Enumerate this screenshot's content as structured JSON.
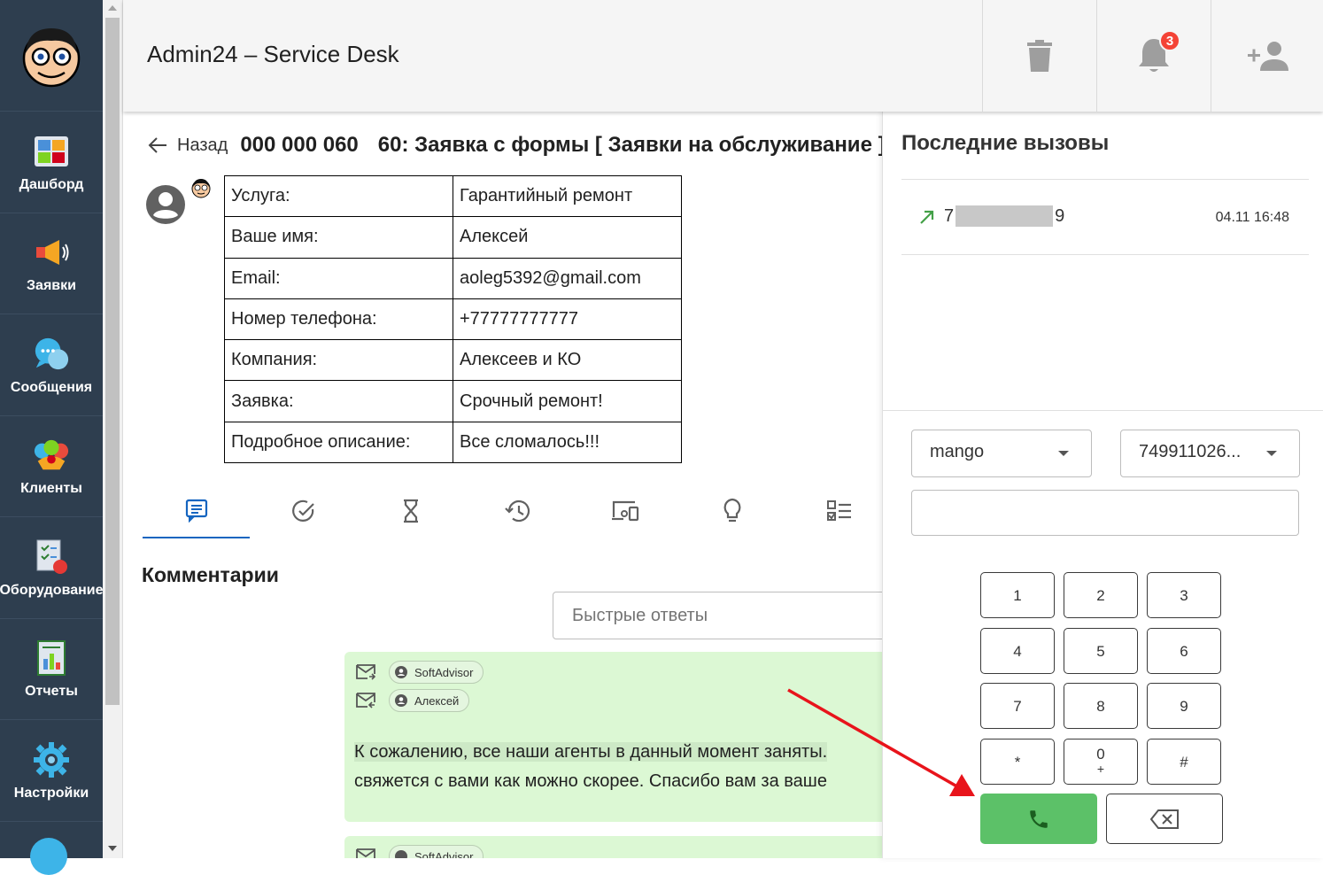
{
  "header": {
    "title": "Admin24 – Service Desk",
    "notification_count": "3"
  },
  "sidebar": {
    "items": [
      {
        "label": "Дашборд",
        "icon": "dashboard-icon"
      },
      {
        "label": "Заявки",
        "icon": "megaphone-icon"
      },
      {
        "label": "Сообщения",
        "icon": "chat-bubbles-icon"
      },
      {
        "label": "Клиенты",
        "icon": "clients-icon"
      },
      {
        "label": "Оборудование",
        "icon": "equipment-icon"
      },
      {
        "label": "Отчеты",
        "icon": "report-icon"
      },
      {
        "label": "Настройки",
        "icon": "gear-icon"
      }
    ]
  },
  "ticket": {
    "back_label": "Назад",
    "number": "000 000 060",
    "title": "60: Заявка с формы [ Заявки на обслуживание ]",
    "fields": [
      {
        "key": "Услуга:",
        "value": "Гарантийный ремонт"
      },
      {
        "key": "Ваше имя:",
        "value": "Алексей"
      },
      {
        "key": "Email:",
        "value": "aoleg5392@gmail.com"
      },
      {
        "key": "Номер телефона:",
        "value": "+77777777777"
      },
      {
        "key": "Компания:",
        "value": "Алексеев и КО"
      },
      {
        "key": "Заявка:",
        "value": "Срочный ремонт!"
      },
      {
        "key": "Подробное описание:",
        "value": "Все сломалось!!!"
      }
    ]
  },
  "tabs": [
    "comments-icon",
    "check-circle-icon",
    "hourglass-icon",
    "history-icon",
    "devices-icon",
    "lightbulb-icon",
    "checklist-icon"
  ],
  "comments": {
    "title": "Комментарии",
    "quick_replies_placeholder": "Быстрые ответы",
    "items": [
      {
        "from": "SoftAdvisor",
        "to": "Алексей",
        "text_line1": "К сожалению, все наши агенты в данный момент заняты.",
        "text_line2": "свяжется с вами как можно скорее. Спасибо вам за ваше"
      },
      {
        "from": "SoftAdvisor"
      }
    ]
  },
  "phone": {
    "recent_title": "Последние вызовы",
    "recent_calls": [
      {
        "number_start": "7",
        "number_end": "9",
        "time": "04.11 16:48"
      }
    ],
    "provider": "mango",
    "line": "749911026...",
    "keys": [
      {
        "main": "1",
        "sub": ""
      },
      {
        "main": "2",
        "sub": ""
      },
      {
        "main": "3",
        "sub": ""
      },
      {
        "main": "4",
        "sub": ""
      },
      {
        "main": "5",
        "sub": ""
      },
      {
        "main": "6",
        "sub": ""
      },
      {
        "main": "7",
        "sub": ""
      },
      {
        "main": "8",
        "sub": ""
      },
      {
        "main": "9",
        "sub": ""
      },
      {
        "main": "*",
        "sub": ""
      },
      {
        "main": "0",
        "sub": "+"
      },
      {
        "main": "#",
        "sub": ""
      }
    ]
  },
  "colors": {
    "sidebar": "#2e3e4f",
    "accent": "#1565c0",
    "call_green": "#5cc168",
    "badge_red": "#f44336",
    "comment_bg": "#dcf8d4",
    "annotation_red": "#e8141b"
  }
}
